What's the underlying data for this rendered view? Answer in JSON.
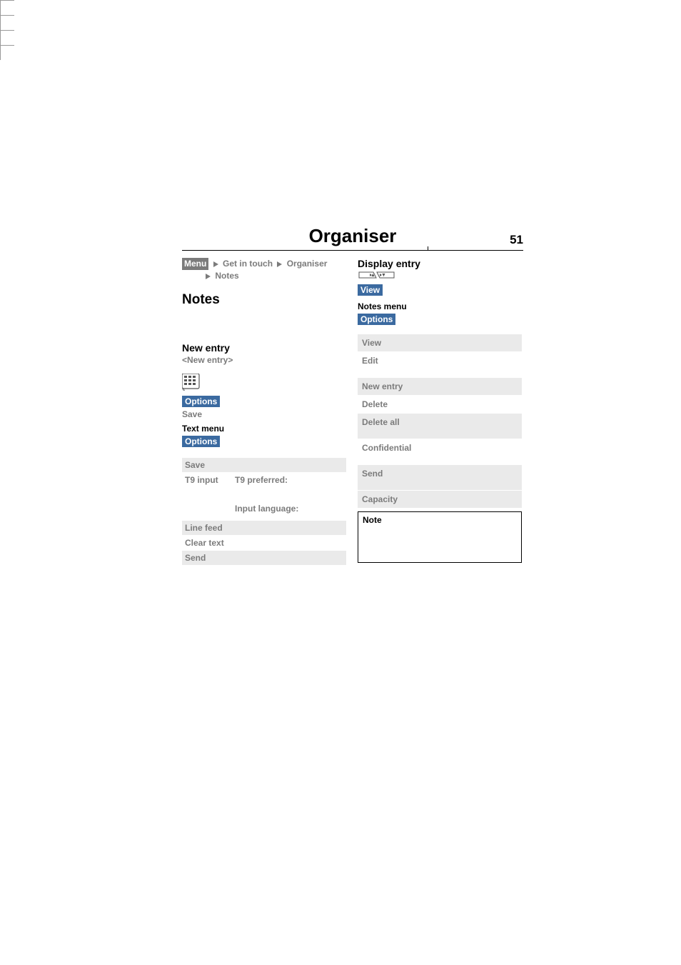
{
  "header": {
    "title": "Organiser",
    "page_number": "51"
  },
  "left": {
    "breadcrumb": {
      "menu_label": "Menu",
      "crumb1": "Get in touch",
      "crumb2": "Organiser",
      "crumb3": "Notes"
    },
    "h1": "Notes",
    "new_entry_h": "New entry",
    "new_entry_sub": "<New entry>",
    "options_label": "Options",
    "save_label": "Save",
    "text_menu_h": "Text menu",
    "options_label_2": "Options",
    "table": {
      "row1": "Save",
      "row2_label": "T9 input",
      "row2_a": "T9 preferred:",
      "row2_b": "Input language:",
      "row3": "Line feed",
      "row4": "Clear text",
      "row5": "Send"
    }
  },
  "right": {
    "display_entry_h": "Display entry",
    "view_label": "View",
    "notes_menu_h": "Notes menu",
    "options_label": "Options",
    "menu": {
      "r1": "View",
      "r2": "Edit",
      "r3": "New entry",
      "r4": "Delete",
      "r5": "Delete all",
      "r6": "Confidential",
      "r7": "Send",
      "r8": "Capacity"
    },
    "note_label": "Note"
  }
}
